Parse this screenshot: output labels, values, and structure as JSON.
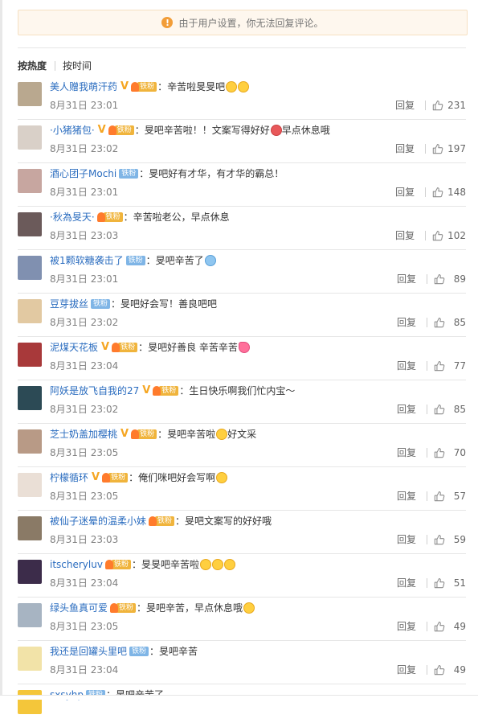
{
  "notice": {
    "icon": "warning-icon",
    "text": "由于用户设置，你无法回复评论。"
  },
  "sort_tabs": [
    {
      "label": "按热度",
      "active": true
    },
    {
      "label": "按时间",
      "active": false
    }
  ],
  "reply_label": "回复",
  "comments": [
    {
      "user": "美人赠我萌汗药",
      "verified": true,
      "fan_badge": "铁粉",
      "badge_color": "gold",
      "text": "：辛苦啦旻旻吧",
      "emojis": [
        "yellow",
        "yellow"
      ],
      "text2": "",
      "time": "8月31日 23:01",
      "likes": "231",
      "avatar_color": "#b9a88f"
    },
    {
      "user": "·小猪猪包·",
      "verified": true,
      "fan_badge": "铁粉",
      "badge_color": "gold",
      "text": "：旻吧辛苦啦！！文案写得好好",
      "emojis": [
        "red"
      ],
      "text2": "早点休息哦",
      "time": "8月31日 23:02",
      "likes": "197",
      "avatar_color": "#d9d0c8"
    },
    {
      "user": "酒心团子Mochi",
      "verified": false,
      "fan_badge": "铁粉",
      "badge_color": "blue",
      "text": "：旻吧好有才华，有才华的霸总！",
      "emojis": [],
      "text2": "",
      "time": "8月31日 23:01",
      "likes": "148",
      "avatar_color": "#c7a6a0"
    },
    {
      "user": "·秋為旻天·",
      "verified": false,
      "fan_badge": "铁粉",
      "badge_color": "gold",
      "text": "：辛苦啦老公，早点休息",
      "emojis": [],
      "text2": "",
      "time": "8月31日 23:03",
      "likes": "102",
      "avatar_color": "#6b5a5a"
    },
    {
      "user": "被1颗软糖袭击了",
      "verified": false,
      "fan_badge": "铁粉",
      "badge_color": "blue",
      "text": "：旻吧辛苦了",
      "emojis": [
        "blue"
      ],
      "text2": "",
      "time": "8月31日 23:01",
      "likes": "89",
      "avatar_color": "#8090b0"
    },
    {
      "user": "豆芽拔丝",
      "verified": false,
      "fan_badge": "铁粉",
      "badge_color": "blue",
      "text": "：旻吧好会写！善良吧吧",
      "emojis": [],
      "text2": "",
      "time": "8月31日 23:02",
      "likes": "85",
      "avatar_color": "#e2c9a2"
    },
    {
      "user": "泥煤天花板",
      "verified": true,
      "fan_badge": "铁粉",
      "badge_color": "gold",
      "text": "：旻吧好善良 辛苦辛苦",
      "emojis": [
        "pink"
      ],
      "text2": "",
      "time": "8月31日 23:04",
      "likes": "77",
      "avatar_color": "#a8393a"
    },
    {
      "user": "阿妖是放飞自我的27",
      "verified": true,
      "fan_badge": "铁粉",
      "badge_color": "gold",
      "text": "：生日快乐啊我们忙内宝～",
      "emojis": [],
      "text2": "",
      "time": "8月31日 23:02",
      "likes": "85",
      "avatar_color": "#2c4a55"
    },
    {
      "user": "芝士奶盖加樱桃",
      "verified": true,
      "fan_badge": "铁粉",
      "badge_color": "gold",
      "text": "：旻吧辛苦啦",
      "emojis": [
        "yellow"
      ],
      "text2": "好文采",
      "time": "8月31日 23:05",
      "likes": "70",
      "avatar_color": "#b89a86"
    },
    {
      "user": "柠檬循环",
      "verified": true,
      "fan_badge": "铁粉",
      "badge_color": "gold",
      "text": "：俺们咪吧好会写啊",
      "emojis": [
        "yellow"
      ],
      "text2": "",
      "time": "8月31日 23:05",
      "likes": "57",
      "avatar_color": "#eadfd6"
    },
    {
      "user": "被仙子迷晕的温柔小妹",
      "verified": false,
      "fan_badge": "铁粉",
      "badge_color": "gold",
      "text": "：旻吧文案写的好好哦",
      "emojis": [],
      "text2": "",
      "time": "8月31日 23:03",
      "likes": "59",
      "avatar_color": "#8a7a66"
    },
    {
      "user": "itscheryluv",
      "verified": false,
      "fan_badge": "铁粉",
      "badge_color": "gold",
      "text": "：旻旻吧辛苦啦",
      "emojis": [
        "yellow",
        "yellow",
        "yellow"
      ],
      "text2": "",
      "time": "8月31日 23:04",
      "likes": "51",
      "avatar_color": "#3c2c4a"
    },
    {
      "user": "绿头鱼真可爱",
      "verified": false,
      "fan_badge": "铁粉",
      "badge_color": "gold",
      "text": "：旻吧辛苦，早点休息哦",
      "emojis": [
        "yellow"
      ],
      "text2": "",
      "time": "8月31日 23:05",
      "likes": "49",
      "avatar_color": "#a7b4c2"
    },
    {
      "user": "我还是回罐头里吧",
      "verified": false,
      "fan_badge": "铁粉",
      "badge_color": "blue",
      "text": "：旻吧辛苦",
      "emojis": [],
      "text2": "",
      "time": "8月31日 23:04",
      "likes": "49",
      "avatar_color": "#f2e3a8"
    },
    {
      "user": "sxsyhp",
      "verified": false,
      "fan_badge": "铁粉",
      "badge_color": "blue",
      "text": "：旻吧辛苦了",
      "emojis": [],
      "text2": "",
      "time": "",
      "likes": "",
      "avatar_color": "#f4c63a"
    }
  ]
}
